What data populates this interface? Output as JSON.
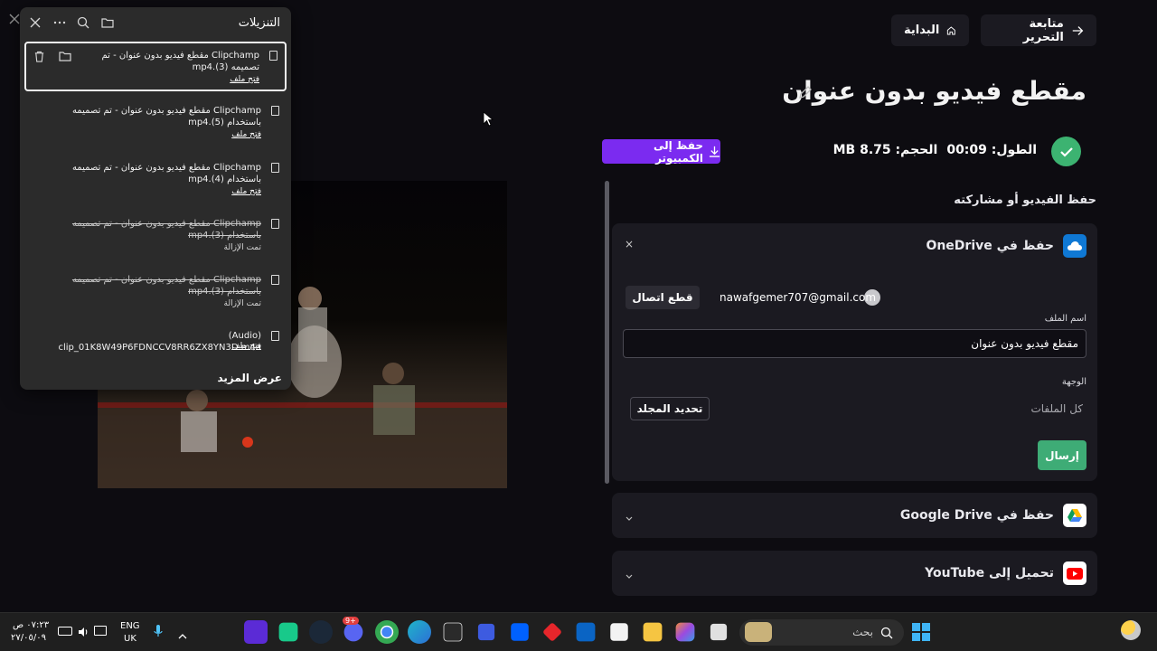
{
  "header": {
    "continue_editing": "متابعة التحرير",
    "home": "البداية"
  },
  "video": {
    "title": "مقطع فيديو بدون عنوان",
    "length_label": "الطول:",
    "length_value": "00:09",
    "size_label": "الحجم:",
    "size_value": "8.75 MB",
    "save_to_pc": "حفظ إلى الكمبيوتر"
  },
  "share_section": {
    "label": "حفظ الفيديو أو مشاركته",
    "onedrive": {
      "title": "حفظ في OneDrive",
      "account_email": "nawafgemer707@gmail.com",
      "disconnect": "قطع اتصال",
      "file_name_label": "اسم الملف",
      "file_name_value": "مقطع فيديو بدون عنوان",
      "destination_label": "الوجهة",
      "destination_value": "كل الملفات",
      "choose_folder": "تحديد المجلد",
      "send": "إرسال",
      "close": "×"
    },
    "google_drive": {
      "title": "حفظ في Google Drive"
    },
    "youtube": {
      "title": "تحميل إلى YouTube"
    }
  },
  "downloads": {
    "title": "التنزيلات",
    "items": [
      {
        "name": "Clipchamp مقطع فيديو بدون عنوان - تم تصميمه (3).mp4",
        "action": "فتح ملف",
        "removed": false
      },
      {
        "name": "Clipchamp مقطع فيديو بدون عنوان - تم تصميمه باستخدام (5).mp4",
        "action": "فتح ملف",
        "removed": false
      },
      {
        "name": "Clipchamp مقطع فيديو بدون عنوان - تم تصميمه باستخدام (4).mp4",
        "action": "فتح ملف",
        "removed": false
      },
      {
        "name": "Clipchamp مقطع فيديو بدون عنوان - تم تصميمه باستخدام (3).mp4",
        "action": "تمت الإزالة",
        "removed": true
      },
      {
        "name": "Clipchamp مقطع فيديو بدون عنوان - تم تصميمه باستخدام (3).mp4",
        "action": "تمت الإزالة",
        "removed": true
      },
      {
        "name": "(Audio) clip_01K8W49P6FDNCCV8RR6ZX8YN3D.m4a",
        "action": "فتح ملف",
        "removed": false
      }
    ],
    "show_more": "عرض المزيد"
  },
  "taskbar": {
    "time": "٠٧:٢٣ ص",
    "date": "٢٧/٠٥/٠٩",
    "lang_top": "ENG",
    "lang_bottom": "UK",
    "search_placeholder": "بحث",
    "notification_badge": "9+"
  },
  "colors": {
    "accent_purple": "#7b2bf0",
    "success_green": "#3eac76",
    "card_bg": "#1b1a21",
    "page_bg": "#0d0c11"
  }
}
